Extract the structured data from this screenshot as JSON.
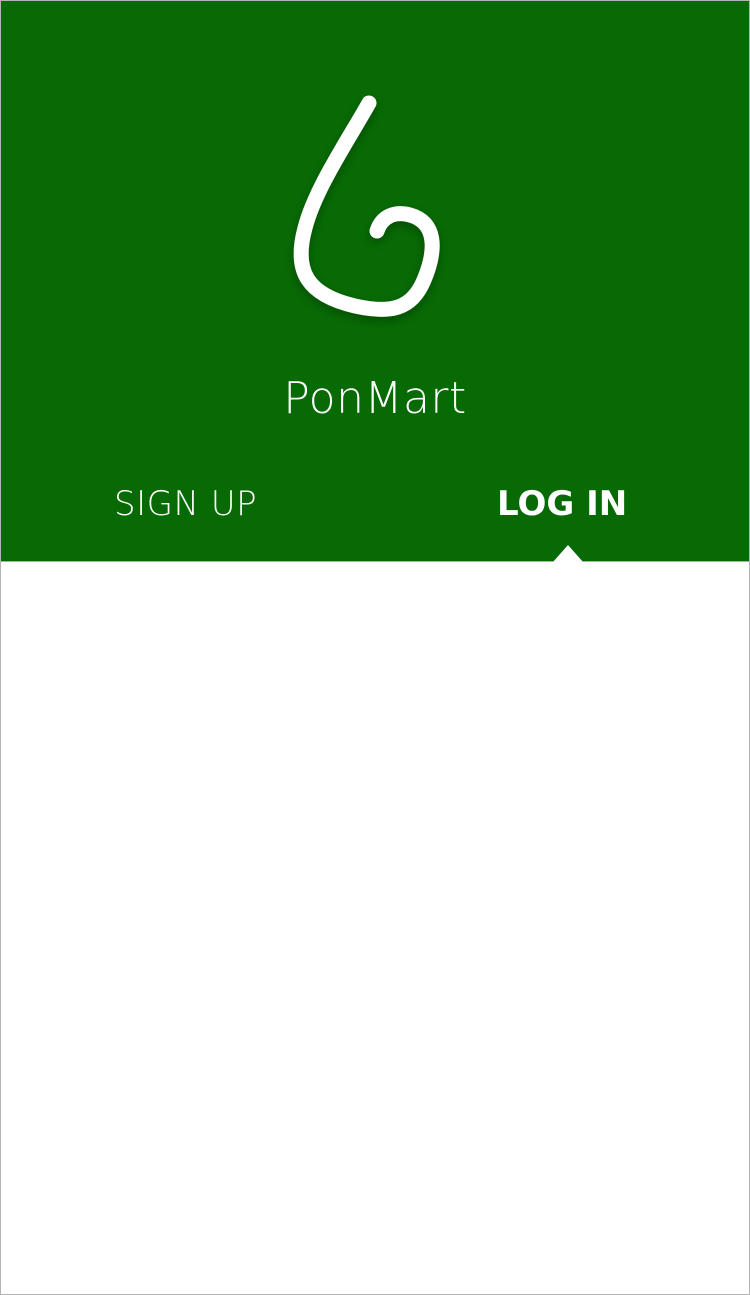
{
  "app": {
    "name": "PonMart",
    "logo_icon": "ponmart-logo-icon",
    "colors": {
      "brand_green": "#076a04",
      "text_on_brand": "#ffffff",
      "background": "#ffffff",
      "border": "#b4b4b4"
    }
  },
  "tabs": [
    {
      "label": "SIGN UP",
      "active": false
    },
    {
      "label": "LOG IN",
      "active": true
    }
  ]
}
